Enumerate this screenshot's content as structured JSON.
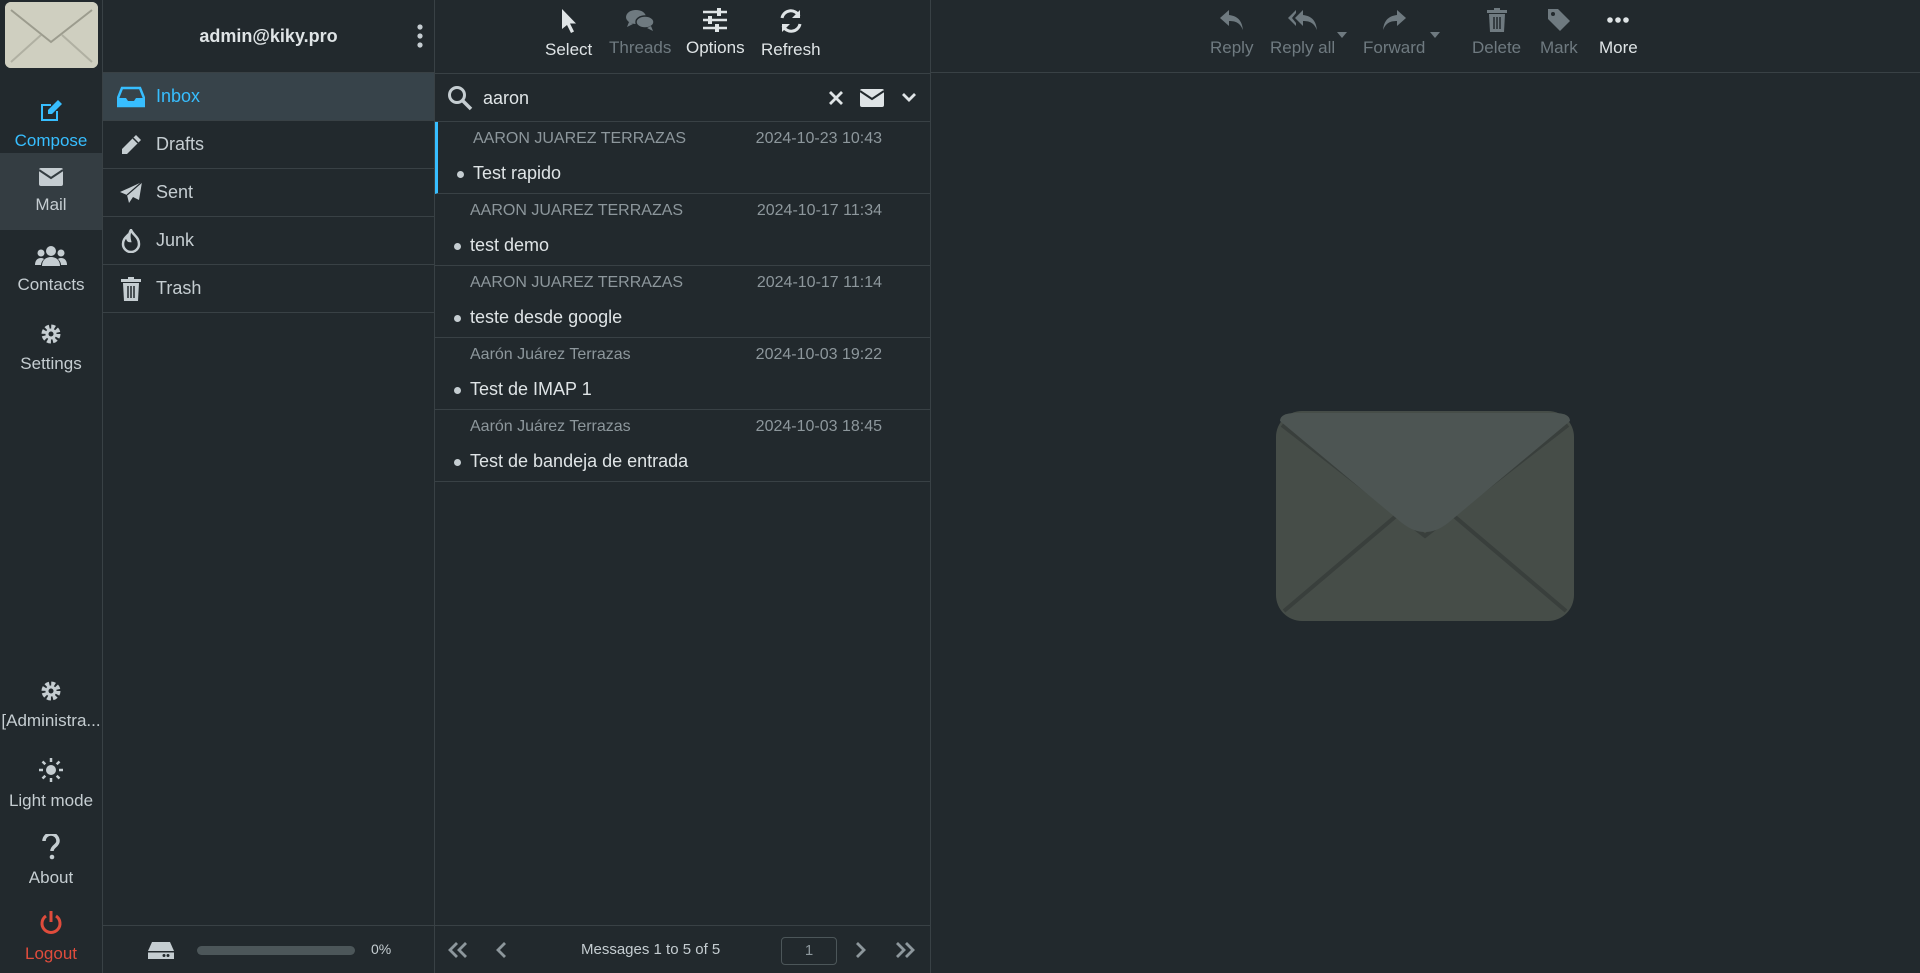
{
  "rail": {
    "compose": "Compose",
    "mail": "Mail",
    "contacts": "Contacts",
    "settings": "Settings",
    "admin": "[Administra...",
    "light_mode": "Light mode",
    "about": "About",
    "logout": "Logout"
  },
  "account": {
    "email": "admin@kiky.pro"
  },
  "folders": [
    {
      "label": "Inbox",
      "icon": "inbox-icon"
    },
    {
      "label": "Drafts",
      "icon": "pencil-icon"
    },
    {
      "label": "Sent",
      "icon": "paper-plane-icon"
    },
    {
      "label": "Junk",
      "icon": "fire-icon"
    },
    {
      "label": "Trash",
      "icon": "trash-icon"
    }
  ],
  "quota": {
    "text": "0%",
    "used_fraction": 0
  },
  "list_toolbar": {
    "select": "Select",
    "threads": "Threads",
    "options": "Options",
    "refresh": "Refresh"
  },
  "search": {
    "value": "aaron"
  },
  "messages": [
    {
      "from": "AARON JUAREZ TERRAZAS",
      "date": "2024-10-23 10:43",
      "subject": "Test rapido"
    },
    {
      "from": "AARON JUAREZ TERRAZAS",
      "date": "2024-10-17 11:34",
      "subject": "test demo"
    },
    {
      "from": "AARON JUAREZ TERRAZAS",
      "date": "2024-10-17 11:14",
      "subject": "teste desde google"
    },
    {
      "from": "Aarón Juárez Terrazas",
      "date": "2024-10-03 19:22",
      "subject": "Test de IMAP 1"
    },
    {
      "from": "Aarón Juárez Terrazas",
      "date": "2024-10-03 18:45",
      "subject": "Test de bandeja de entrada"
    }
  ],
  "list_footer": {
    "count": "Messages 1 to 5 of 5",
    "page": "1"
  },
  "preview_toolbar": {
    "reply": "Reply",
    "reply_all": "Reply all",
    "forward": "Forward",
    "delete": "Delete",
    "mark": "Mark",
    "more": "More"
  },
  "colors": {
    "accent": "#37beff",
    "background": "#22292d",
    "logout": "#e04c3c"
  }
}
